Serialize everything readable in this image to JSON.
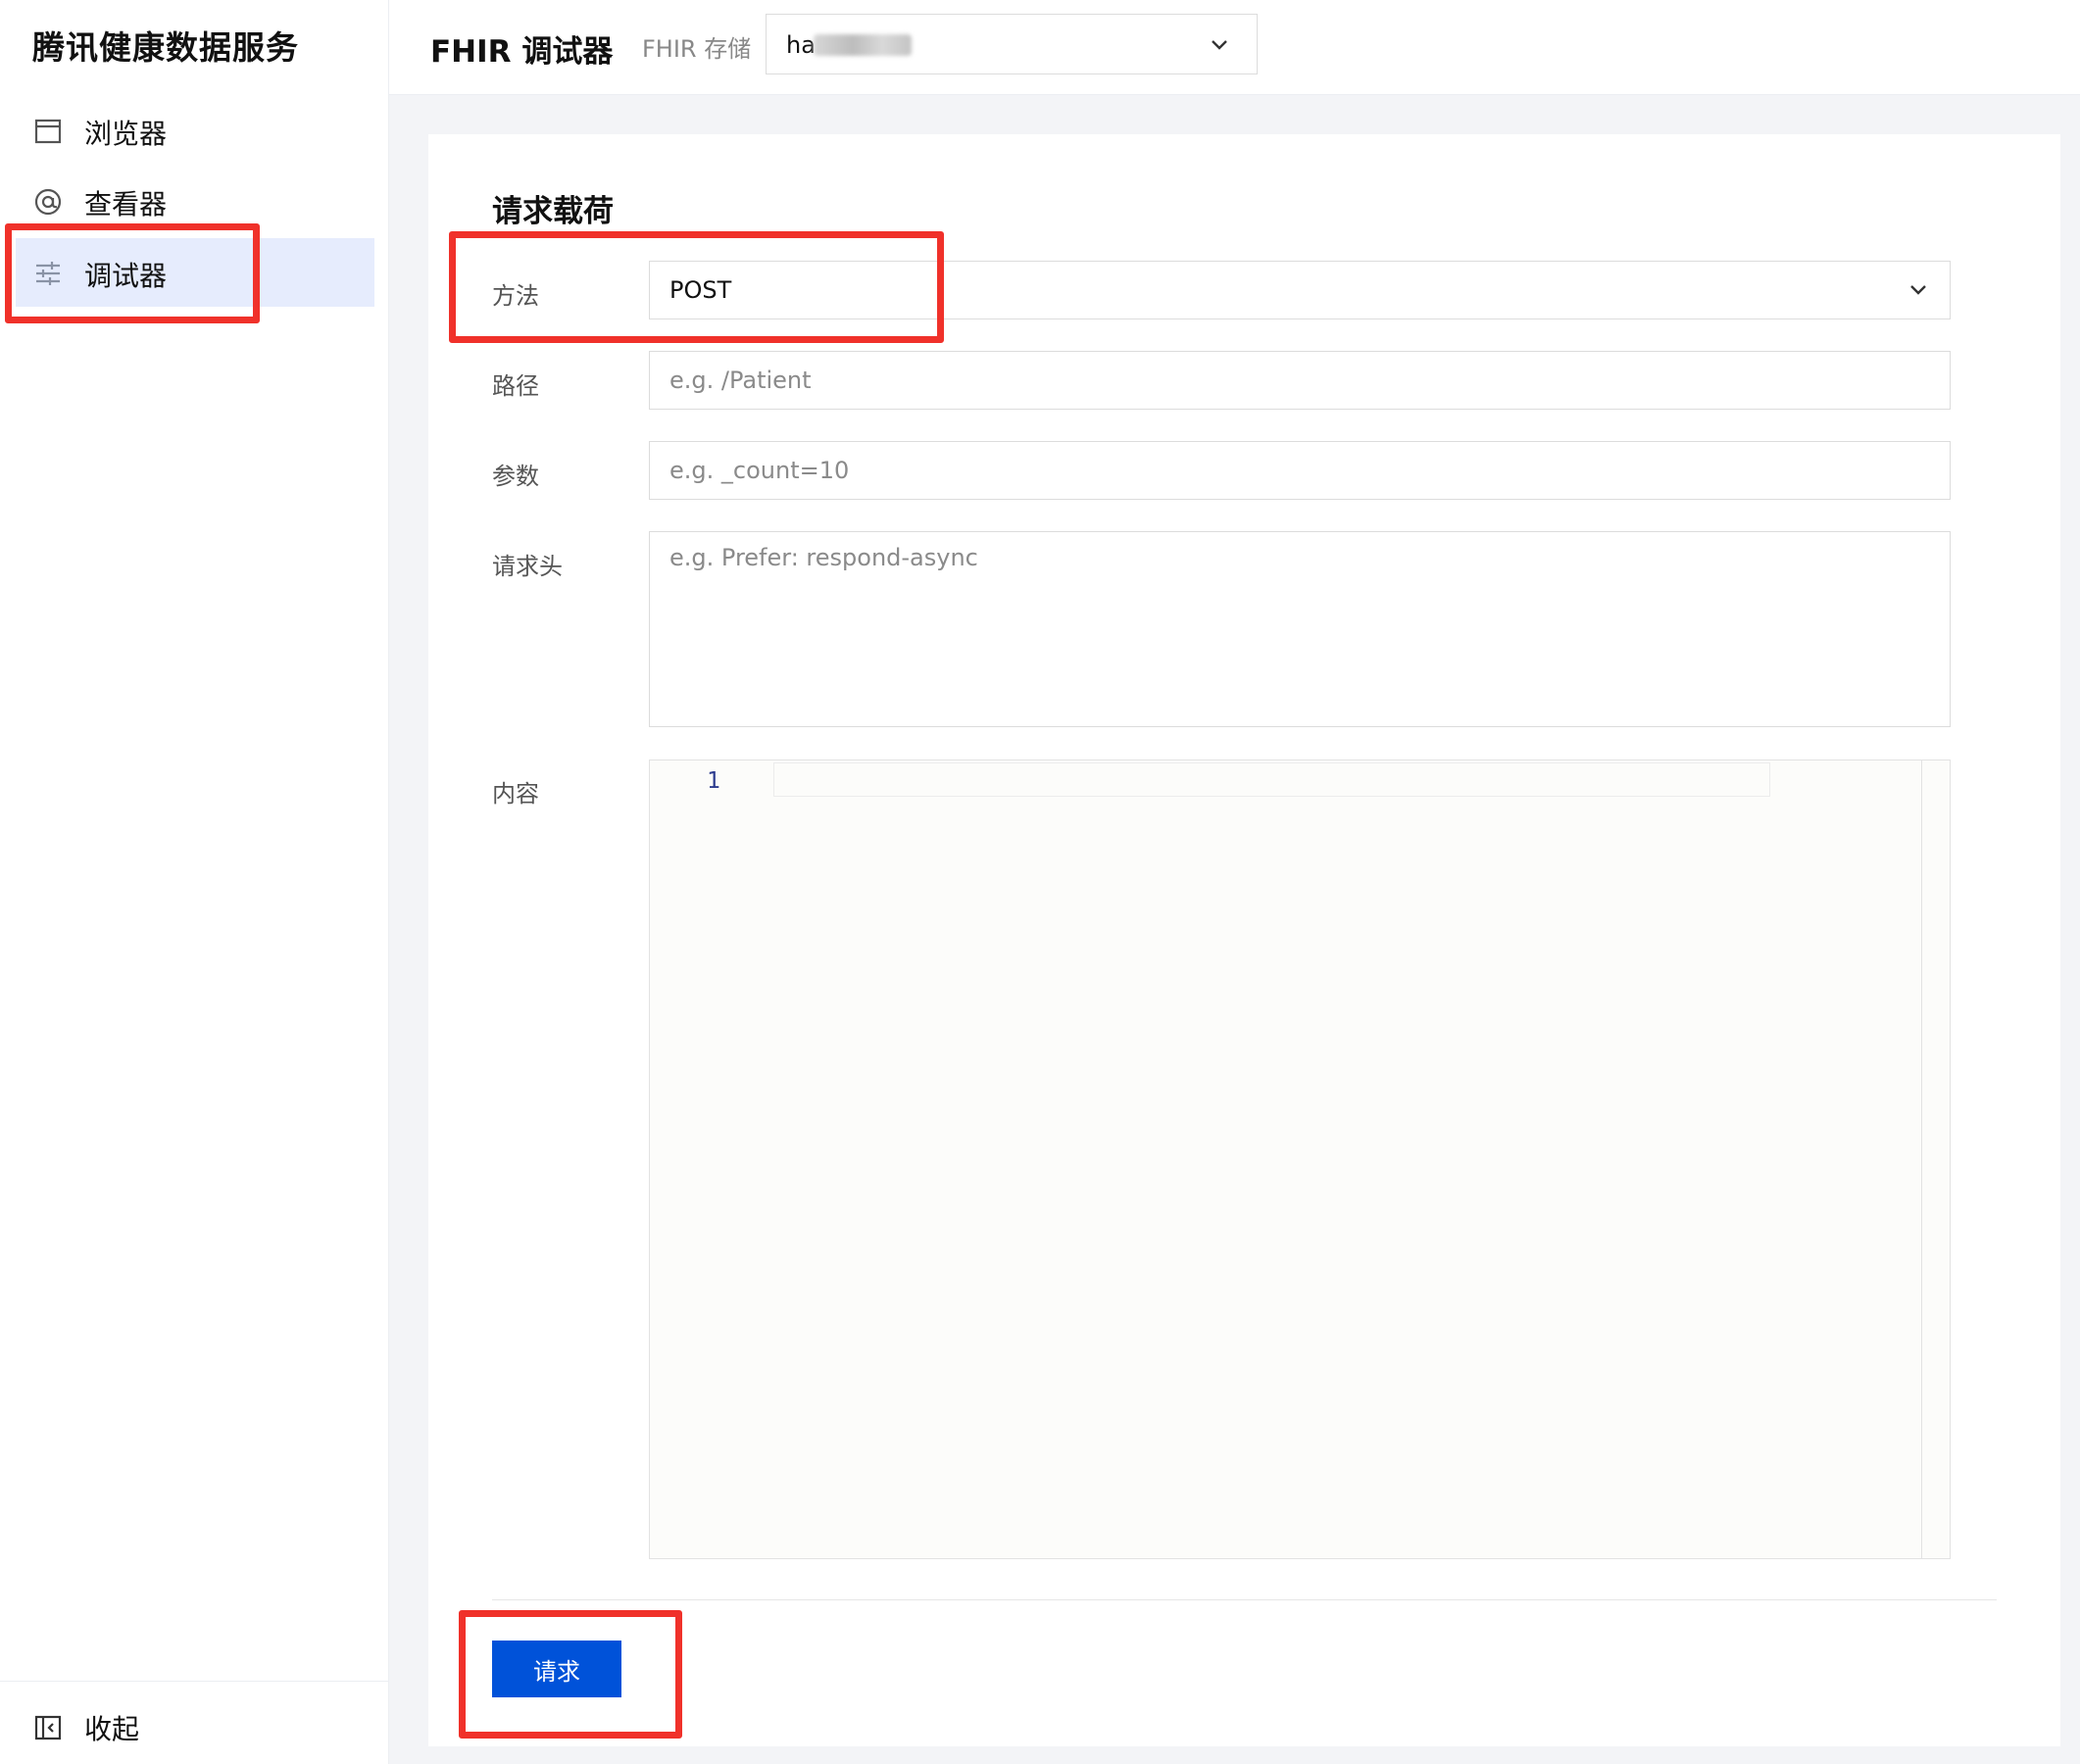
{
  "sidebar": {
    "brand": "腾讯健康数据服务",
    "items": [
      {
        "label": "浏览器",
        "icon": "browser-window-icon"
      },
      {
        "label": "查看器",
        "icon": "at-sign-icon"
      },
      {
        "label": "调试器",
        "icon": "sliders-icon",
        "active": true
      }
    ],
    "collapse": {
      "label": "收起",
      "icon": "collapse-sidebar-icon"
    }
  },
  "header": {
    "title": "FHIR 调试器",
    "store_label": "FHIR 存储",
    "store_value": "ha"
  },
  "form": {
    "section_title": "请求载荷",
    "method": {
      "label": "方法",
      "value": "POST"
    },
    "path": {
      "label": "路径",
      "placeholder": "e.g. /Patient"
    },
    "params": {
      "label": "参数",
      "placeholder": "e.g. _count=10"
    },
    "headers": {
      "label": "请求头",
      "placeholder": "e.g. Prefer: respond-async"
    },
    "body": {
      "label": "内容",
      "line_number": "1"
    },
    "submit_label": "请求"
  },
  "colors": {
    "accent": "#0052d9",
    "active_bg": "#e6ecfd",
    "highlight": "#f0312a"
  }
}
